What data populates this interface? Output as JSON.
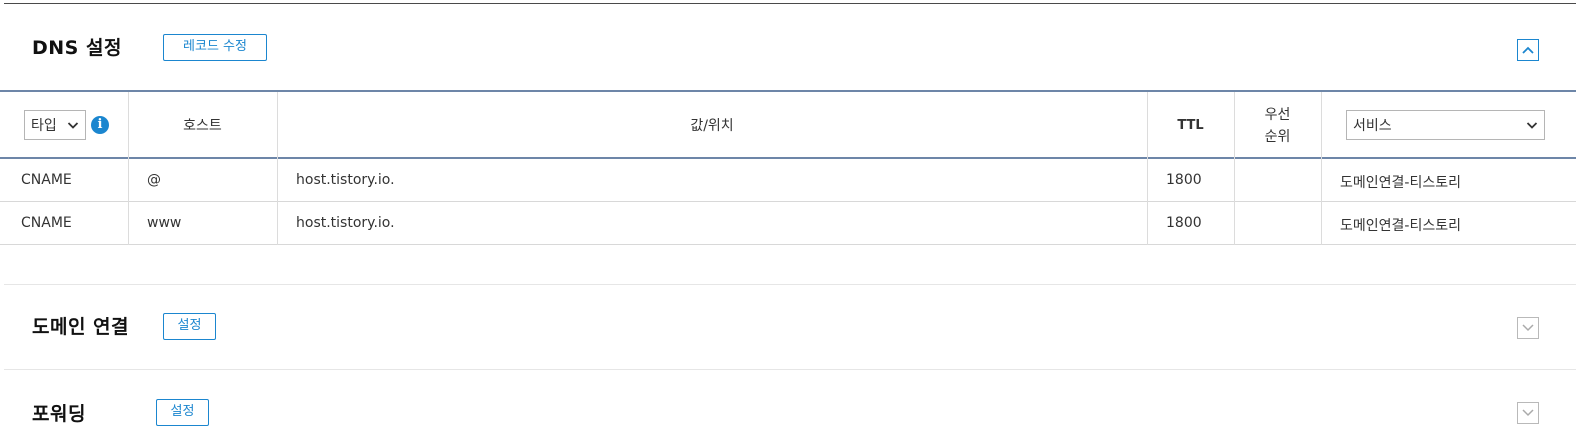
{
  "dns": {
    "title": "DNS 설정",
    "edit_button": "레코드 수정"
  },
  "table": {
    "type_filter": "타입",
    "col_host": "호스트",
    "col_value": "값/위치",
    "col_ttl": "TTL",
    "col_priority_1": "우선",
    "col_priority_2": "순위",
    "service_select": "서비스",
    "rows": [
      {
        "type": "CNAME",
        "host": "@",
        "value": "host.tistory.io.",
        "ttl": "1800",
        "priority": "",
        "service": "도메인연결-티스토리"
      },
      {
        "type": "CNAME",
        "host": "www",
        "value": "host.tistory.io.",
        "ttl": "1800",
        "priority": "",
        "service": "도메인연결-티스토리"
      }
    ]
  },
  "domain_link": {
    "title": "도메인 연결",
    "button": "설정"
  },
  "forwarding": {
    "title": "포워딩",
    "button": "설정"
  },
  "colors": {
    "accent": "#1b86cf",
    "header_rule": "#6d86a8"
  }
}
